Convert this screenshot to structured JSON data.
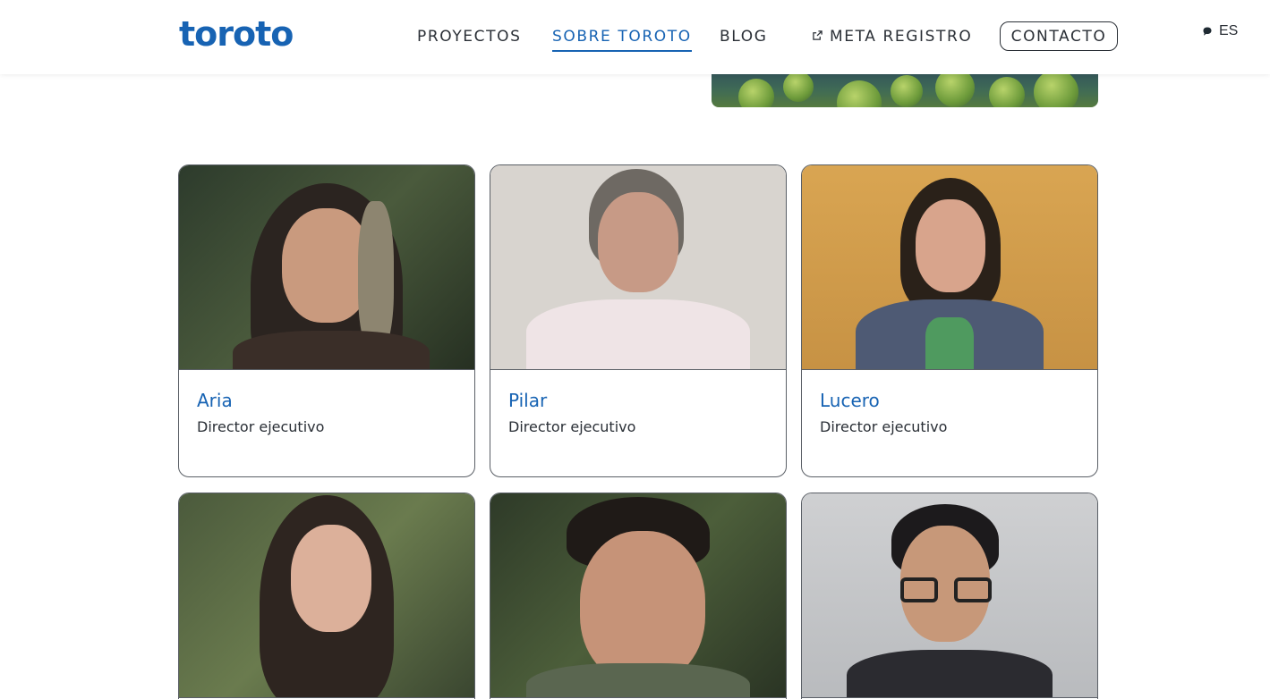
{
  "brand": {
    "logo_text": "toroto",
    "accent": "#1763b3"
  },
  "nav": {
    "items": [
      {
        "label": "PROYECTOS",
        "active": false
      },
      {
        "label": "SOBRE TOROTO",
        "active": true
      },
      {
        "label": "BLOG",
        "active": false
      },
      {
        "label": "META REGISTRO",
        "active": false,
        "icon": "external-link-icon"
      }
    ],
    "contact_label": "CONTACTO",
    "language": {
      "label": "ES",
      "icon": "chat-bubble-icon"
    }
  },
  "team": [
    {
      "name": "Aria",
      "role": "Director ejecutivo"
    },
    {
      "name": "Pilar",
      "role": "Director ejecutivo"
    },
    {
      "name": "Lucero",
      "role": "Director ejecutivo"
    },
    {
      "name": "",
      "role": ""
    },
    {
      "name": "",
      "role": ""
    },
    {
      "name": "",
      "role": ""
    }
  ]
}
